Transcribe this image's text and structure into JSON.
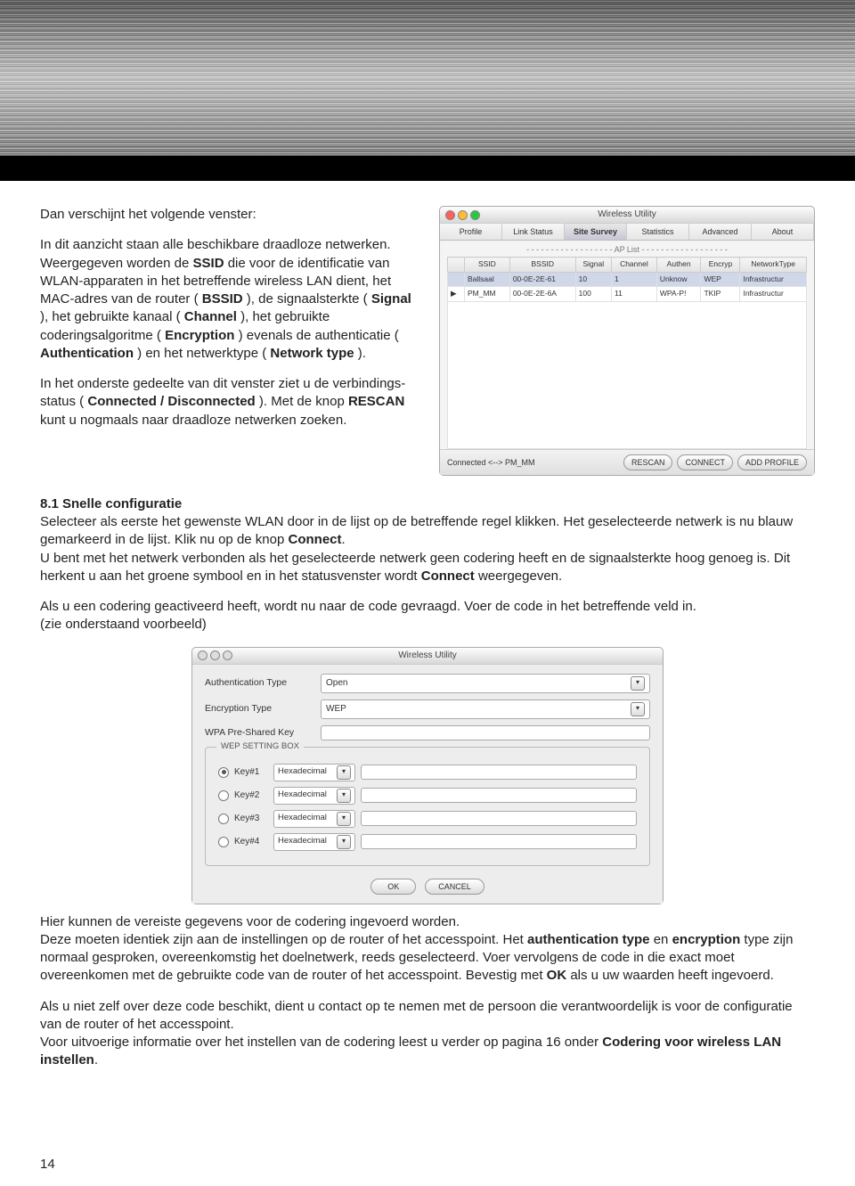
{
  "doc": {
    "intro": "Dan verschijnt het volgende venster:",
    "p1a": "In dit aanzicht staan alle beschikbare draadloze netwerken. Weergegeven worden de ",
    "p1_SSID": "SSID",
    "p1b": " die voor de identificatie van WLAN-apparaten in het betreffende wireless LAN dient, het MAC-adres van de router (",
    "p1_BSSID": "BSSID",
    "p1c": "), de signaalsterkte (",
    "p1_Signal": "Signal",
    "p1d": "), het gebruikte kanaal (",
    "p1_Channel": "Channel",
    "p1e": "), het gebruikte coderingsalgoritme (",
    "p1_Encryption": "Encryption",
    "p1f": ") evenals de authenticatie (",
    "p1_Authentication": "Authentication",
    "p1g": ") en het netwerktype (",
    "p1_Network": "Network type",
    "p1h": ").",
    "p2a": "In het onderste gedeelte van dit venster ziet u de verbindings-status (",
    "p2_cd": "Connected / Disconnected",
    "p2b": "). Met de knop ",
    "p2_rescan": "RESCAN",
    "p2c": " kunt u nogmaals naar draadloze netwerken zoeken.",
    "sec81_title": "8.1 Snelle configuratie",
    "sec81_a": "Selecteer als eerste het gewenste WLAN door in de lijst op de betreffende regel klikken. Het geselecteerde netwerk is nu blauw gemarkeerd in de lijst. Klik nu op de knop ",
    "sec81_connect": "Connect",
    "sec81_b": "U bent met het netwerk verbonden als het geselecteerde netwerk geen codering heeft en de signaalsterkte hoog genoeg is. Dit herkent u aan het groene symbool en in het statusvenster wordt ",
    "sec81_connect2": "Connect",
    "sec81_c": " weergegeven.",
    "codep1": "Als u een codering geactiveerd heeft, wordt nu naar de code gevraagd. Voer de code in het betreffende veld in.",
    "codep2": "(zie onderstaand voorbeeld)",
    "after1": "Hier kunnen de vereiste gegevens voor de codering ingevoerd worden.",
    "after2a": "Deze moeten identiek zijn aan de instellingen op de router of het accesspoint. Het ",
    "after2_auth": "authentication type",
    "after2b": " en ",
    "after2_enc": "encryption",
    "after2c": " type zijn normaal gesproken, overeenkomstig het doelnetwerk, reeds geselecteerd. Voer vervolgens de code in die exact moet overeenkomen met de gebruikte code van de router of het accesspoint. Bevestig met ",
    "after2_ok": "OK",
    "after2d": " als u uw waarden heeft ingevoerd.",
    "contact1": "Als u niet zelf over deze code beschikt, dient u contact op te nemen met de persoon die verantwoordelijk is voor de configuratie van de router of het accesspoint.",
    "contact2a": "Voor uitvoerige informatie over het instellen van de codering leest u verder op pagina 16 onder ",
    "contact2_link": "Codering voor wireless LAN instellen",
    "pagenum": "14"
  },
  "ap": {
    "title": "Wireless Utility",
    "tabs": [
      "Profile",
      "Link Status",
      "Site Survey",
      "Statistics",
      "Advanced",
      "About"
    ],
    "list_label": " AP List ",
    "cols": [
      "",
      "SSID",
      "BSSID",
      "Signal",
      "Channel",
      "Authen",
      "Encryp",
      "NetworkType"
    ],
    "rows": [
      {
        "ssid": "Ballsaal",
        "bssid": "00-0E-2E-61",
        "signal": "10",
        "channel": "1",
        "authen": "Unknow",
        "encryp": "WEP",
        "ntype": "Infrastructur"
      },
      {
        "ssid": "PM_MM",
        "bssid": "00-0E-2E-6A",
        "signal": "100",
        "channel": "11",
        "authen": "WPA-P!",
        "encryp": "TKIP",
        "ntype": "Infrastructur"
      }
    ],
    "status": "Connected <--> PM_MM",
    "buttons": [
      "RESCAN",
      "CONNECT",
      "ADD PROFILE"
    ]
  },
  "dlg": {
    "title": "Wireless Utility",
    "auth_label": "Authentication Type",
    "auth_value": "Open",
    "enc_label": "Encryption Type",
    "enc_value": "WEP",
    "wpa_label": "WPA Pre-Shared Key",
    "wep_title": "WEP SETTING BOX",
    "keys": [
      "Key#1",
      "Key#2",
      "Key#3",
      "Key#4"
    ],
    "hex": "Hexadecimal",
    "ok": "OK",
    "cancel": "CANCEL"
  }
}
